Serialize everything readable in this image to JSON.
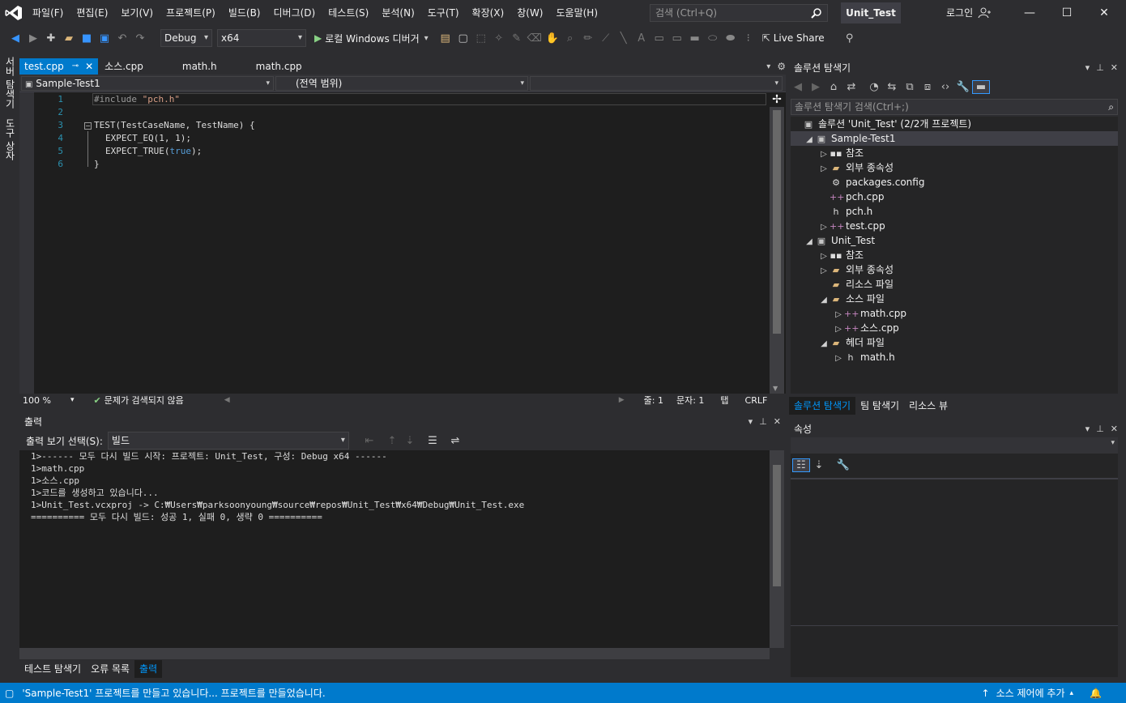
{
  "menu": [
    "파일(F)",
    "편집(E)",
    "보기(V)",
    "프로젝트(P)",
    "빌드(B)",
    "디버그(D)",
    "테스트(S)",
    "분석(N)",
    "도구(T)",
    "확장(X)",
    "창(W)",
    "도움말(H)"
  ],
  "search": {
    "placeholder": "검색 (Ctrl+Q)"
  },
  "window": {
    "title": "Unit_Test",
    "login": "로그인"
  },
  "toolbar": {
    "config": "Debug",
    "platform": "x64",
    "debugger": "로컬 Windows 디버거",
    "live_share": "Live Share"
  },
  "side_tabs": [
    "서버 탐색기",
    "도구 상자"
  ],
  "editor_tabs": [
    {
      "label": "test.cpp",
      "active": true
    },
    {
      "label": "소스.cpp",
      "active": false
    },
    {
      "label": "math.h",
      "active": false
    },
    {
      "label": "math.cpp",
      "active": false
    }
  ],
  "nav": {
    "project": "Sample-Test1",
    "scope": "(전역 범위)"
  },
  "code": {
    "line_numbers": [
      "1",
      "2",
      "3",
      "4",
      "5",
      "6"
    ],
    "l1_pre": "#include",
    "l1_str": "\"pch.h\"",
    "l3": "TEST(TestCaseName, TestName) {",
    "l4": "EXPECT_EQ(1, 1);",
    "l5_a": "EXPECT_TRUE(",
    "l5_kw": "true",
    "l5_b": ");",
    "l6": "}"
  },
  "editor_status": {
    "zoom": "100 %",
    "issues": "문제가 검색되지 않음",
    "line": "줄: 1",
    "col": "문자: 1",
    "tab": "탭",
    "eol": "CRLF"
  },
  "output": {
    "title": "출력",
    "show_from_label": "출력 보기 선택(S):",
    "show_from_value": "빌드",
    "lines": [
      "1>------ 모두 다시 빌드 시작: 프로젝트: Unit_Test, 구성: Debug x64 ------",
      "1>math.cpp",
      "1>소스.cpp",
      "1>코드를 생성하고 있습니다...",
      "1>Unit_Test.vcxproj -> C:₩Users₩parksoonyoung₩source₩repos₩Unit_Test₩x64₩Debug₩Unit_Test.exe",
      "========== 모두 다시 빌드: 성공 1, 실패 0, 생략 0 =========="
    ]
  },
  "bottom_tabs": [
    {
      "label": "테스트 탐색기",
      "active": false
    },
    {
      "label": "오류 목록",
      "active": false
    },
    {
      "label": "출력",
      "active": true
    }
  ],
  "solution_explorer": {
    "title": "솔루션 탐색기",
    "search_placeholder": "솔루션 탐색기 검색(Ctrl+;)",
    "tree": [
      {
        "label": "솔루션 'Unit_Test' (2/2개 프로젝트)",
        "icon": "solution-icon",
        "arrow": ""
      },
      {
        "label": "Sample-Test1",
        "icon": "project-icon",
        "arrow": "open"
      },
      {
        "label": "참조",
        "icon": "references-icon",
        "arrow": "closed"
      },
      {
        "label": "외부 종속성",
        "icon": "folder-icon",
        "arrow": "closed"
      },
      {
        "label": "packages.config",
        "icon": "config-file-icon",
        "arrow": ""
      },
      {
        "label": "pch.cpp",
        "icon": "cpp-file-icon",
        "arrow": ""
      },
      {
        "label": "pch.h",
        "icon": "header-file-icon",
        "arrow": ""
      },
      {
        "label": "test.cpp",
        "icon": "cpp-file-icon",
        "arrow": "closed"
      },
      {
        "label": "Unit_Test",
        "icon": "project-icon",
        "arrow": "open"
      },
      {
        "label": "참조",
        "icon": "references-icon",
        "arrow": "closed"
      },
      {
        "label": "외부 종속성",
        "icon": "folder-icon",
        "arrow": "closed"
      },
      {
        "label": "리소스 파일",
        "icon": "folder-icon",
        "arrow": ""
      },
      {
        "label": "소스 파일",
        "icon": "folder-icon",
        "arrow": "open"
      },
      {
        "label": "math.cpp",
        "icon": "cpp-file-icon",
        "arrow": "closed"
      },
      {
        "label": "소스.cpp",
        "icon": "cpp-file-icon",
        "arrow": "closed"
      },
      {
        "label": "헤더 파일",
        "icon": "folder-icon",
        "arrow": "open"
      },
      {
        "label": "math.h",
        "icon": "header-file-icon",
        "arrow": "closed"
      }
    ],
    "tabs": [
      {
        "label": "솔루션 탐색기",
        "active": true
      },
      {
        "label": "팀 탐색기",
        "active": false
      },
      {
        "label": "리소스 뷰",
        "active": false
      }
    ]
  },
  "properties": {
    "title": "속성"
  },
  "statusbar": {
    "message": "'Sample-Test1' 프로젝트를 만들고 있습니다... 프로젝트를 만들었습니다.",
    "source_control": "소스 제어에 추가"
  },
  "colors": {
    "accent": "#007acc",
    "background": "#2d2d30",
    "editor_bg": "#1e1e1e",
    "line_number": "#2b91af",
    "keyword": "#569cd6",
    "string": "#d69d85"
  }
}
